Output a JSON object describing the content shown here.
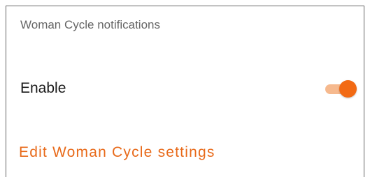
{
  "section": {
    "title": "Woman Cycle notifications"
  },
  "enable_row": {
    "label": "Enable",
    "toggle_state": "on"
  },
  "edit_link": {
    "label": "Edit Woman Cycle settings"
  },
  "colors": {
    "accent": "#f26a14",
    "track_on": "#f6b98e",
    "header_text": "#666666",
    "body_text": "#1a1a1a"
  }
}
